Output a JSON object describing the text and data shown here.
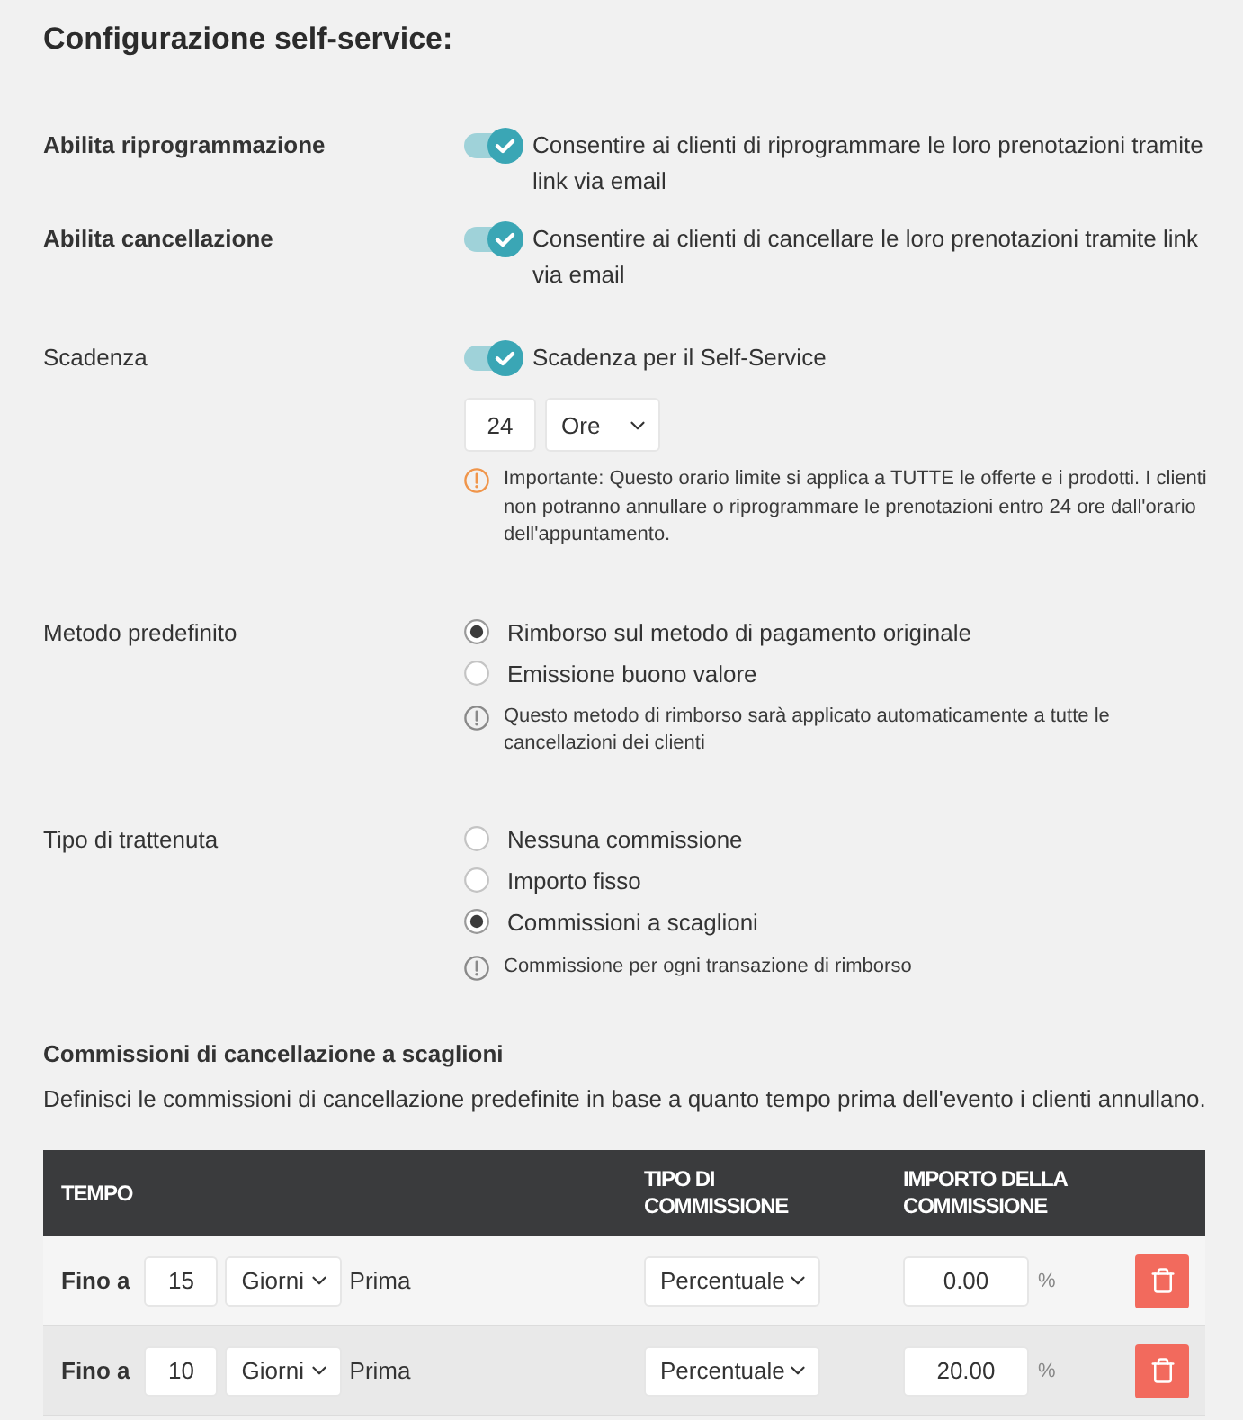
{
  "title": "Configurazione self-service:",
  "toggles": [
    {
      "label": "Abilita riprogrammazione",
      "on": true,
      "text": "Consentire ai clienti di riprogrammare le loro prenotazioni tramite link via email"
    },
    {
      "label": "Abilita cancellazione",
      "on": true,
      "text": "Consentire ai clienti di cancellare le loro prenotazioni tramite link via email"
    }
  ],
  "deadline": {
    "label": "Scadenza",
    "on": true,
    "text": "Scadenza per il Self-Service",
    "amount": "24",
    "unit": "Ore",
    "note": {
      "kind": "warning",
      "text": "Importante: Questo orario limite si applica a TUTTE le offerte e i prodotti. I clienti non potranno annullare o riprogrammare le prenotazioni entro 24 ore dall'orario dell'appuntamento."
    }
  },
  "default_method": {
    "label": "Metodo predefinito",
    "options": [
      {
        "label": "Rimborso sul metodo di pagamento originale",
        "selected": true
      },
      {
        "label": "Emissione buono valore",
        "selected": false
      }
    ],
    "note": {
      "kind": "info",
      "text": "Questo metodo di rimborso sarà applicato automaticamente a tutte le cancellazioni dei clienti"
    }
  },
  "fee_type": {
    "label": "Tipo di trattenuta",
    "options": [
      {
        "label": "Nessuna commissione",
        "selected": false
      },
      {
        "label": "Importo fisso",
        "selected": false
      },
      {
        "label": "Commissioni a scaglioni",
        "selected": true
      }
    ],
    "note": {
      "kind": "info",
      "text": "Commissione per ogni transazione di rimborso"
    }
  },
  "tiers": {
    "title": "Commissioni di cancellazione a scaglioni",
    "description": "Definisci le commissioni di cancellazione predefinite in base a quanto tempo prima dell'evento i clienti annullano.",
    "columns": [
      "TEMPO",
      "TIPO DI COMMISSIONE",
      "IMPORTO DELLA COMMISSIONE"
    ],
    "rows": [
      {
        "prefix": "Fino a",
        "amount": "15",
        "unit": "Giorni",
        "suffix": "Prima",
        "fee_type": "Percentuale",
        "fee": "0.00",
        "fee_unit": "%"
      },
      {
        "prefix": "Fino a",
        "amount": "10",
        "unit": "Giorni",
        "suffix": "Prima",
        "fee_type": "Percentuale",
        "fee": "20.00",
        "fee_unit": "%"
      }
    ]
  }
}
